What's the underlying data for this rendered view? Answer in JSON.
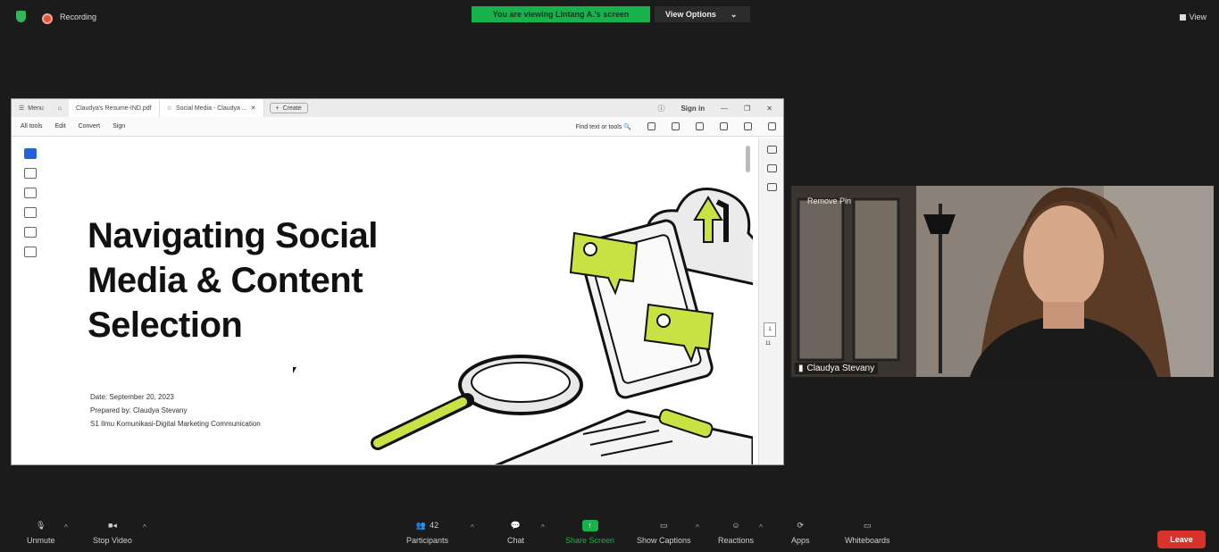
{
  "topbar": {
    "recording_label": "Recording",
    "viewing_banner": "You are viewing Lintang A.'s screen",
    "view_options": "View Options",
    "view_button": "View"
  },
  "acrobat": {
    "tabs": {
      "menu": "Menu",
      "file1": "Claudya's Resume-IND.pdf",
      "file2": "Social Media - Claudya ...",
      "create": "Create"
    },
    "sign_in": "Sign in",
    "toolbar": {
      "all_tools": "All tools",
      "edit": "Edit",
      "convert": "Convert",
      "sign": "Sign",
      "find": "Find text or tools"
    },
    "page_number": "1",
    "page_total": "11"
  },
  "slide": {
    "title_line1": "Navigating Social",
    "title_line2": "Media & Content",
    "title_line3": "Selection",
    "date": "Date: September 20, 2023",
    "prepared_by": "Prepared by: Claudya Stevany",
    "program": "S1 Ilmu Komunikasi-Digital Marketing Communication",
    "accent_color": "#c9e243"
  },
  "participant": {
    "name": "Claudya Stevany",
    "remove_pin": "Remove Pin"
  },
  "bottombar": {
    "unmute": "Unmute",
    "stop_video": "Stop Video",
    "participants": "Participants",
    "participants_count": "42",
    "chat": "Chat",
    "share_screen": "Share Screen",
    "show_captions": "Show Captions",
    "reactions": "Reactions",
    "apps": "Apps",
    "whiteboards": "Whiteboards",
    "leave": "Leave"
  }
}
